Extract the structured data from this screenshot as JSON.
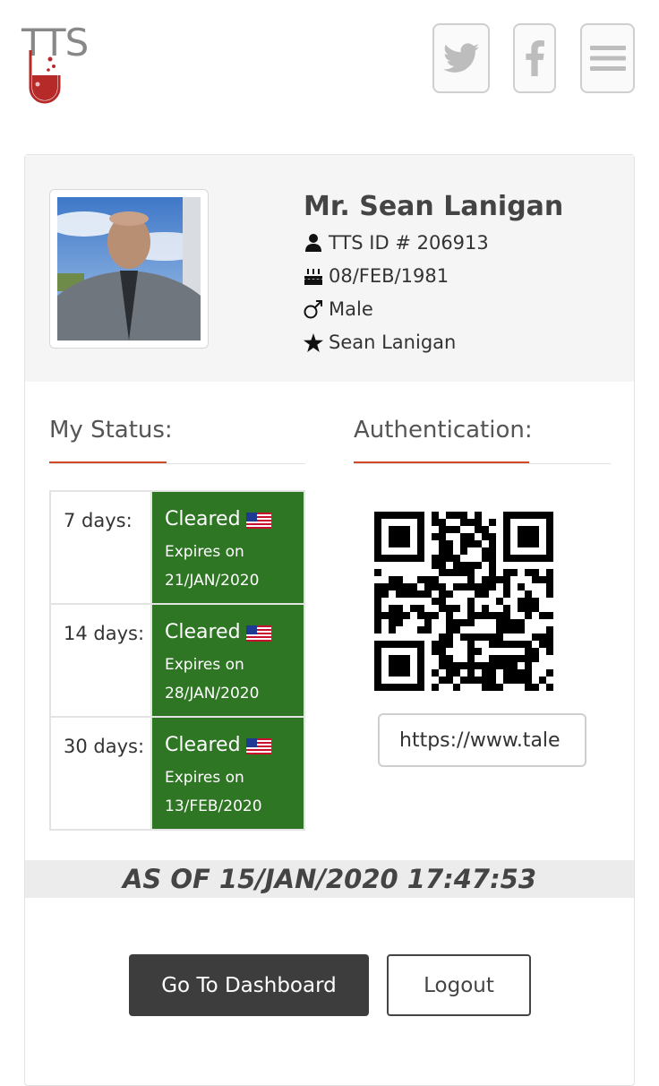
{
  "header": {
    "logo_text_t": "T",
    "logo_text_ts": "TS",
    "twitter_icon": "twitter-icon",
    "facebook_icon": "facebook-icon",
    "menu_icon": "hamburger-menu-icon"
  },
  "profile": {
    "name": "Mr. Sean Lanigan",
    "tts_id": "TTS ID # 206913",
    "dob": "08/FEB/1981",
    "gender": "Male",
    "alias": "Sean Lanigan"
  },
  "sections": {
    "status_title": "My Status:",
    "auth_title": "Authentication:"
  },
  "status": [
    {
      "period": "7 days:",
      "state": "Cleared",
      "expires_label": "Expires on",
      "expires": "21/JAN/2020"
    },
    {
      "period": "14 days:",
      "state": "Cleared",
      "expires_label": "Expires on",
      "expires": "28/JAN/2020"
    },
    {
      "period": "30 days:",
      "state": "Cleared",
      "expires_label": "Expires on",
      "expires": "13/FEB/2020"
    }
  ],
  "auth": {
    "url": "https://www.tale"
  },
  "as_of": "AS OF 15/JAN/2020 17:47:53",
  "buttons": {
    "dashboard": "Go To Dashboard",
    "logout": "Logout"
  },
  "colors": {
    "accent": "#d04a2a",
    "cleared_green": "#2e7524",
    "dark_button": "#3d3d3d"
  }
}
